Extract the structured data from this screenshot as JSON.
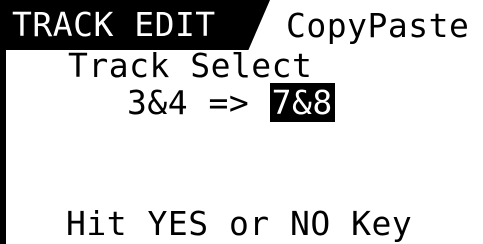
{
  "header": {
    "tab_label": "TRACK EDIT",
    "mode_label": "CopyPaste"
  },
  "track_select": {
    "title": "Track Select",
    "source": "3&4",
    "arrow": "=>",
    "destination": "7&8"
  },
  "prompt": {
    "message": "Hit YES or NO Key"
  },
  "colors": {
    "screen_background": "#ffffff",
    "text": "#000000",
    "highlight_background": "#000000",
    "highlight_text": "#ffffff"
  }
}
